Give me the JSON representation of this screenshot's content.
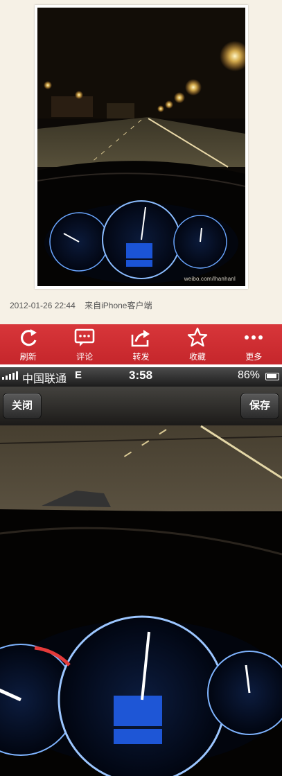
{
  "post": {
    "watermark": "weibo.com/lhanhanl",
    "timestamp": "2012-01-26 22:44",
    "source": "来自iPhone客户端"
  },
  "toolbar": {
    "items": [
      {
        "label": "刷新",
        "icon": "refresh-icon"
      },
      {
        "label": "评论",
        "icon": "comment-icon"
      },
      {
        "label": "转发",
        "icon": "repost-icon"
      },
      {
        "label": "收藏",
        "icon": "star-icon"
      },
      {
        "label": "更多",
        "icon": "more-icon"
      }
    ],
    "color": "#d0302f"
  },
  "statusbar": {
    "carrier": "中国联通",
    "network": "E",
    "time": "3:58",
    "battery": "86%"
  },
  "viewer": {
    "close_label": "关闭",
    "save_label": "保存"
  }
}
